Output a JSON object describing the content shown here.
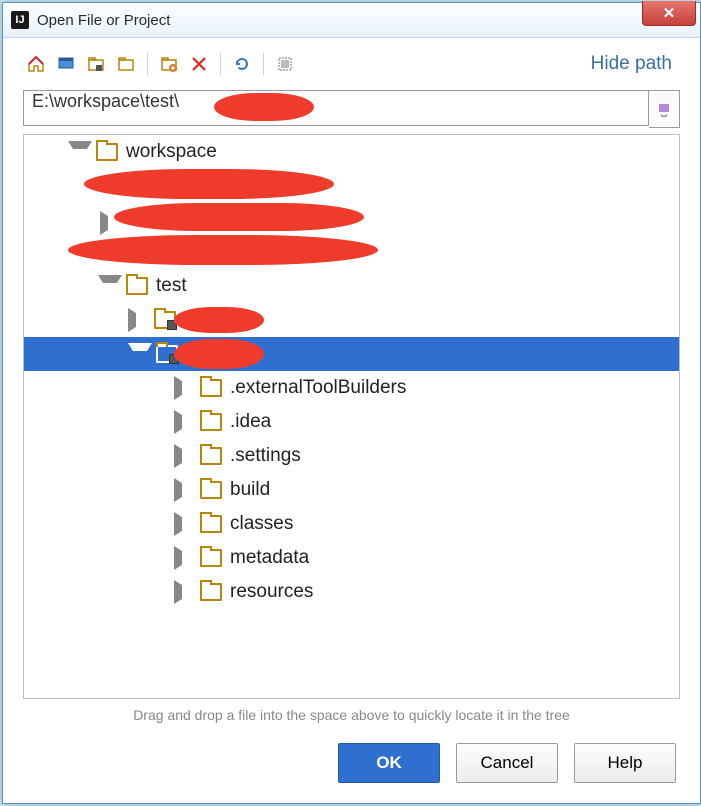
{
  "window": {
    "title": "Open File or Project",
    "app_icon_text": "IJ",
    "close_glyph": "✕"
  },
  "toolbar": {
    "hide_path_label": "Hide path",
    "icons": [
      "home",
      "desktop",
      "project",
      "module",
      "new-folder",
      "delete",
      "refresh",
      "show-hidden"
    ]
  },
  "path": {
    "value": "E:\\workspace\\test\\",
    "redacted_suffix": true
  },
  "tree": {
    "root": {
      "label": "workspace",
      "expanded": true
    },
    "redacted_rows": 3,
    "test": {
      "label": "test",
      "expanded": true,
      "children": [
        {
          "label": "",
          "redacted": true,
          "expanded": false,
          "icon": "module"
        },
        {
          "label": "",
          "redacted": true,
          "expanded": true,
          "selected": true,
          "icon": "module",
          "children": [
            {
              "label": ".externalToolBuilders"
            },
            {
              "label": ".idea"
            },
            {
              "label": ".settings"
            },
            {
              "label": "build"
            },
            {
              "label": "classes"
            },
            {
              "label": "metadata"
            },
            {
              "label": "resources"
            }
          ]
        }
      ]
    }
  },
  "hint": "Drag and drop a file into the space above to quickly locate it in the tree",
  "buttons": {
    "ok": "OK",
    "cancel": "Cancel",
    "help": "Help"
  }
}
